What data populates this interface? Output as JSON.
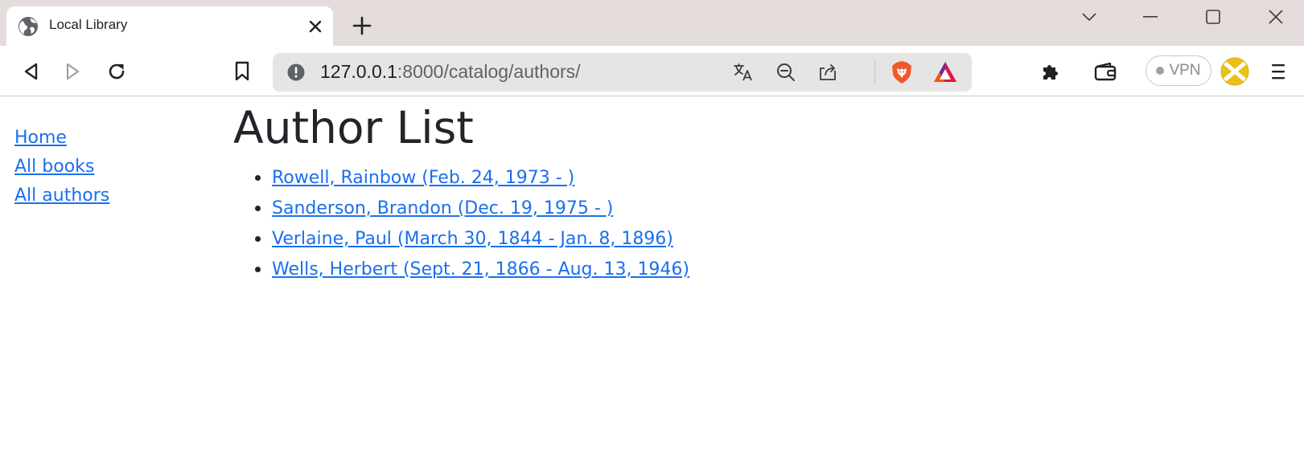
{
  "browser": {
    "tab": {
      "title": "Local Library"
    },
    "address": {
      "host": "127.0.0.1",
      "path": ":8000/catalog/authors/"
    },
    "vpn_label": "VPN",
    "colors": {
      "accent_link": "#1a6ff0",
      "brave_orange": "#f1592a",
      "bat_red": "#e0173b",
      "bat_purple": "#662d91"
    }
  },
  "sidebar": {
    "links": [
      {
        "label": "Home"
      },
      {
        "label": "All books"
      },
      {
        "label": "All authors"
      }
    ]
  },
  "main": {
    "title": "Author List",
    "authors": [
      {
        "label": "Rowell, Rainbow (Feb. 24, 1973 - )"
      },
      {
        "label": "Sanderson, Brandon (Dec. 19, 1975 - )"
      },
      {
        "label": "Verlaine, Paul (March 30, 1844 - Jan. 8, 1896)"
      },
      {
        "label": "Wells, Herbert (Sept. 21, 1866 - Aug. 13, 1946)"
      }
    ]
  }
}
